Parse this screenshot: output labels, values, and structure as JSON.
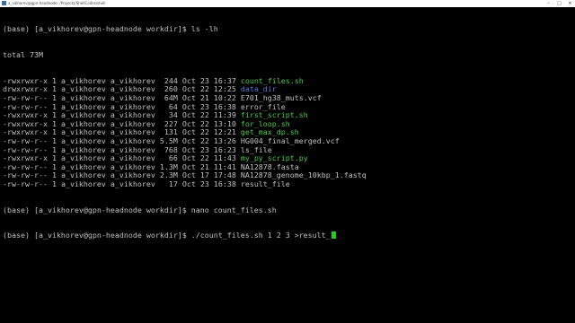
{
  "window": {
    "title": "a_vikhorev@gpn-headnode: /Projects/ShellCodes/shell"
  },
  "terminal": {
    "prompt": "(base) [a_vikhorev@gpn-headnode workdir]$",
    "commands": {
      "ls": " ls -lh",
      "nano": " nano count_files.sh",
      "current": " ./count_files.sh 1 2 3 >result_"
    },
    "total": "total 73M",
    "listing": [
      {
        "perm": "-rwxrwxr-x",
        "links": "1",
        "user": "a_vikhorev",
        "group": "a_vikhorev",
        "size": " 244",
        "month": "Oct",
        "day": "23",
        "time": "16:37",
        "name": "count_files.sh",
        "kind": "exec"
      },
      {
        "perm": "drwxrwxr-x",
        "links": "1",
        "user": "a_vikhorev",
        "group": "a_vikhorev",
        "size": " 260",
        "month": "Oct",
        "day": "22",
        "time": "12:25",
        "name": "data_dir",
        "kind": "dir"
      },
      {
        "perm": "-rw-rw-r--",
        "links": "1",
        "user": "a_vikhorev",
        "group": "a_vikhorev",
        "size": " 64M",
        "month": "Oct",
        "day": "21",
        "time": "10:22",
        "name": "E701_hg38_muts.vcf",
        "kind": "file"
      },
      {
        "perm": "-rw-rw-r--",
        "links": "1",
        "user": "a_vikhorev",
        "group": "a_vikhorev",
        "size": "  64",
        "month": "Oct",
        "day": "23",
        "time": "16:38",
        "name": "error_file",
        "kind": "file"
      },
      {
        "perm": "-rwxrwxr-x",
        "links": "1",
        "user": "a_vikhorev",
        "group": "a_vikhorev",
        "size": "  34",
        "month": "Oct",
        "day": "22",
        "time": "11:39",
        "name": "first_script.sh",
        "kind": "exec"
      },
      {
        "perm": "-rwxrwxr-x",
        "links": "1",
        "user": "a_vikhorev",
        "group": "a_vikhorev",
        "size": " 227",
        "month": "Oct",
        "day": "22",
        "time": "13:10",
        "name": "for_loop.sh",
        "kind": "exec"
      },
      {
        "perm": "-rwxrwxr-x",
        "links": "1",
        "user": "a_vikhorev",
        "group": "a_vikhorev",
        "size": " 131",
        "month": "Oct",
        "day": "22",
        "time": "12:21",
        "name": "get_max_dp.sh",
        "kind": "exec"
      },
      {
        "perm": "-rw-rw-r--",
        "links": "1",
        "user": "a_vikhorev",
        "group": "a_vikhorev",
        "size": "5.5M",
        "month": "Oct",
        "day": "22",
        "time": "13:26",
        "name": "HG004_final_merged.vcf",
        "kind": "file"
      },
      {
        "perm": "-rw-rw-r--",
        "links": "1",
        "user": "a_vikhorev",
        "group": "a_vikhorev",
        "size": " 768",
        "month": "Oct",
        "day": "23",
        "time": "16:23",
        "name": "ls_file",
        "kind": "file"
      },
      {
        "perm": "-rwxrwxr-x",
        "links": "1",
        "user": "a_vikhorev",
        "group": "a_vikhorev",
        "size": "  66",
        "month": "Oct",
        "day": "22",
        "time": "11:43",
        "name": "my_py_script.py",
        "kind": "exec"
      },
      {
        "perm": "-rw-rw-r--",
        "links": "1",
        "user": "a_vikhorev",
        "group": "a_vikhorev",
        "size": "1.3M",
        "month": "Oct",
        "day": "21",
        "time": "11:41",
        "name": "NA12878.fasta",
        "kind": "file"
      },
      {
        "perm": "-rw-rw-r--",
        "links": "1",
        "user": "a_vikhorev",
        "group": "a_vikhorev",
        "size": "2.3M",
        "month": "Oct",
        "day": "17",
        "time": "17:48",
        "name": "NA12878_genome_10kbp_1.fastq",
        "kind": "file"
      },
      {
        "perm": "-rw-rw-r--",
        "links": "1",
        "user": "a_vikhorev",
        "group": "a_vikhorev",
        "size": "  17",
        "month": "Oct",
        "day": "23",
        "time": "16:38",
        "name": "result_file",
        "kind": "file"
      }
    ]
  },
  "colors": {
    "background": "#000000",
    "text": "#c0c0c0",
    "executable": "#4ec94e",
    "directory": "#5a7ad8",
    "cursor": "#20d020"
  },
  "icons": {
    "app": "terminal-icon",
    "minimize": "minimize-icon",
    "maximize": "maximize-icon",
    "close": "close-icon"
  }
}
